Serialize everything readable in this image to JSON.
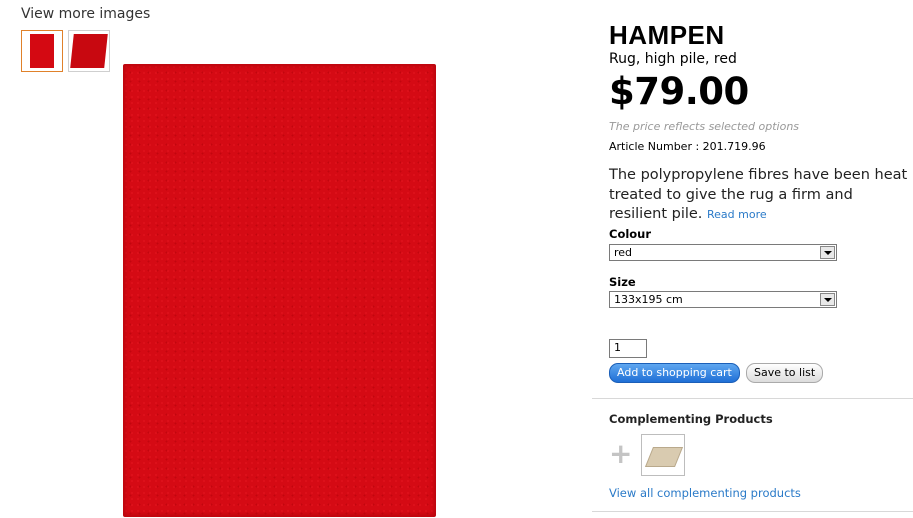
{
  "gallery": {
    "view_more_label": "View more images"
  },
  "product": {
    "name": "HAMPEN",
    "description": "Rug, high pile, red",
    "price": "$79.00",
    "price_note": "The price reflects selected options",
    "article_number": "Article Number : 201.719.96",
    "long_description": "The polypropylene fibres have been heat treated to give the rug a firm and resilient pile.",
    "read_more_label": "Read more"
  },
  "options": {
    "colour_label": "Colour",
    "colour_value": "red",
    "size_label": "Size",
    "size_value": "133x195 cm"
  },
  "purchase": {
    "quantity": "1",
    "add_to_cart_label": "Add to shopping cart",
    "save_to_list_label": "Save to list"
  },
  "complementing": {
    "title": "Complementing Products",
    "view_all_label": "View all complementing products"
  },
  "colors": {
    "rug_red": "#d50a14",
    "link_blue": "#2a7ac8",
    "button_blue": "#1f6fd6",
    "selected_thumb_border": "#e0812a"
  }
}
